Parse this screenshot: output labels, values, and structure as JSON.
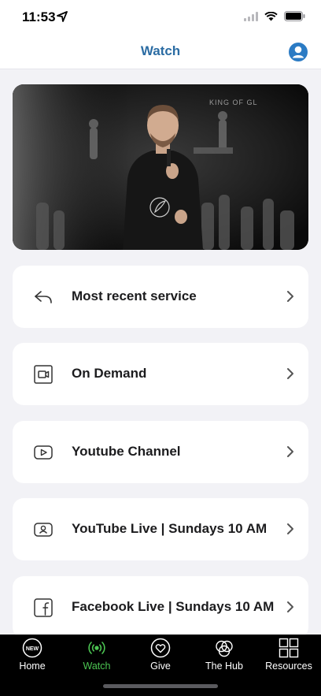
{
  "status": {
    "time": "11:53"
  },
  "header": {
    "title": "Watch"
  },
  "hero": {
    "banner_text": "KING OF GL"
  },
  "menu": [
    {
      "label": "Most recent service",
      "icon": "reply-arrow-icon"
    },
    {
      "label": "On Demand",
      "icon": "video-camera-icon"
    },
    {
      "label": "Youtube Channel",
      "icon": "youtube-play-icon"
    },
    {
      "label": "YouTube Live | Sundays 10 AM",
      "icon": "profile-card-icon"
    },
    {
      "label": "Facebook Live | Sundays 10 AM",
      "icon": "facebook-icon"
    }
  ],
  "tabs": [
    {
      "label": "Home",
      "icon": "new-badge-icon",
      "badge": "NEW"
    },
    {
      "label": "Watch",
      "icon": "broadcast-icon",
      "active": true
    },
    {
      "label": "Give",
      "icon": "heart-icon"
    },
    {
      "label": "The Hub",
      "icon": "circles-icon"
    },
    {
      "label": "Resources",
      "icon": "grid-icon"
    }
  ],
  "colors": {
    "accent_blue": "#2b6ca3",
    "active_tab": "#4cc552",
    "tabbar_bg": "#000000",
    "page_bg": "#f2f2f6"
  }
}
